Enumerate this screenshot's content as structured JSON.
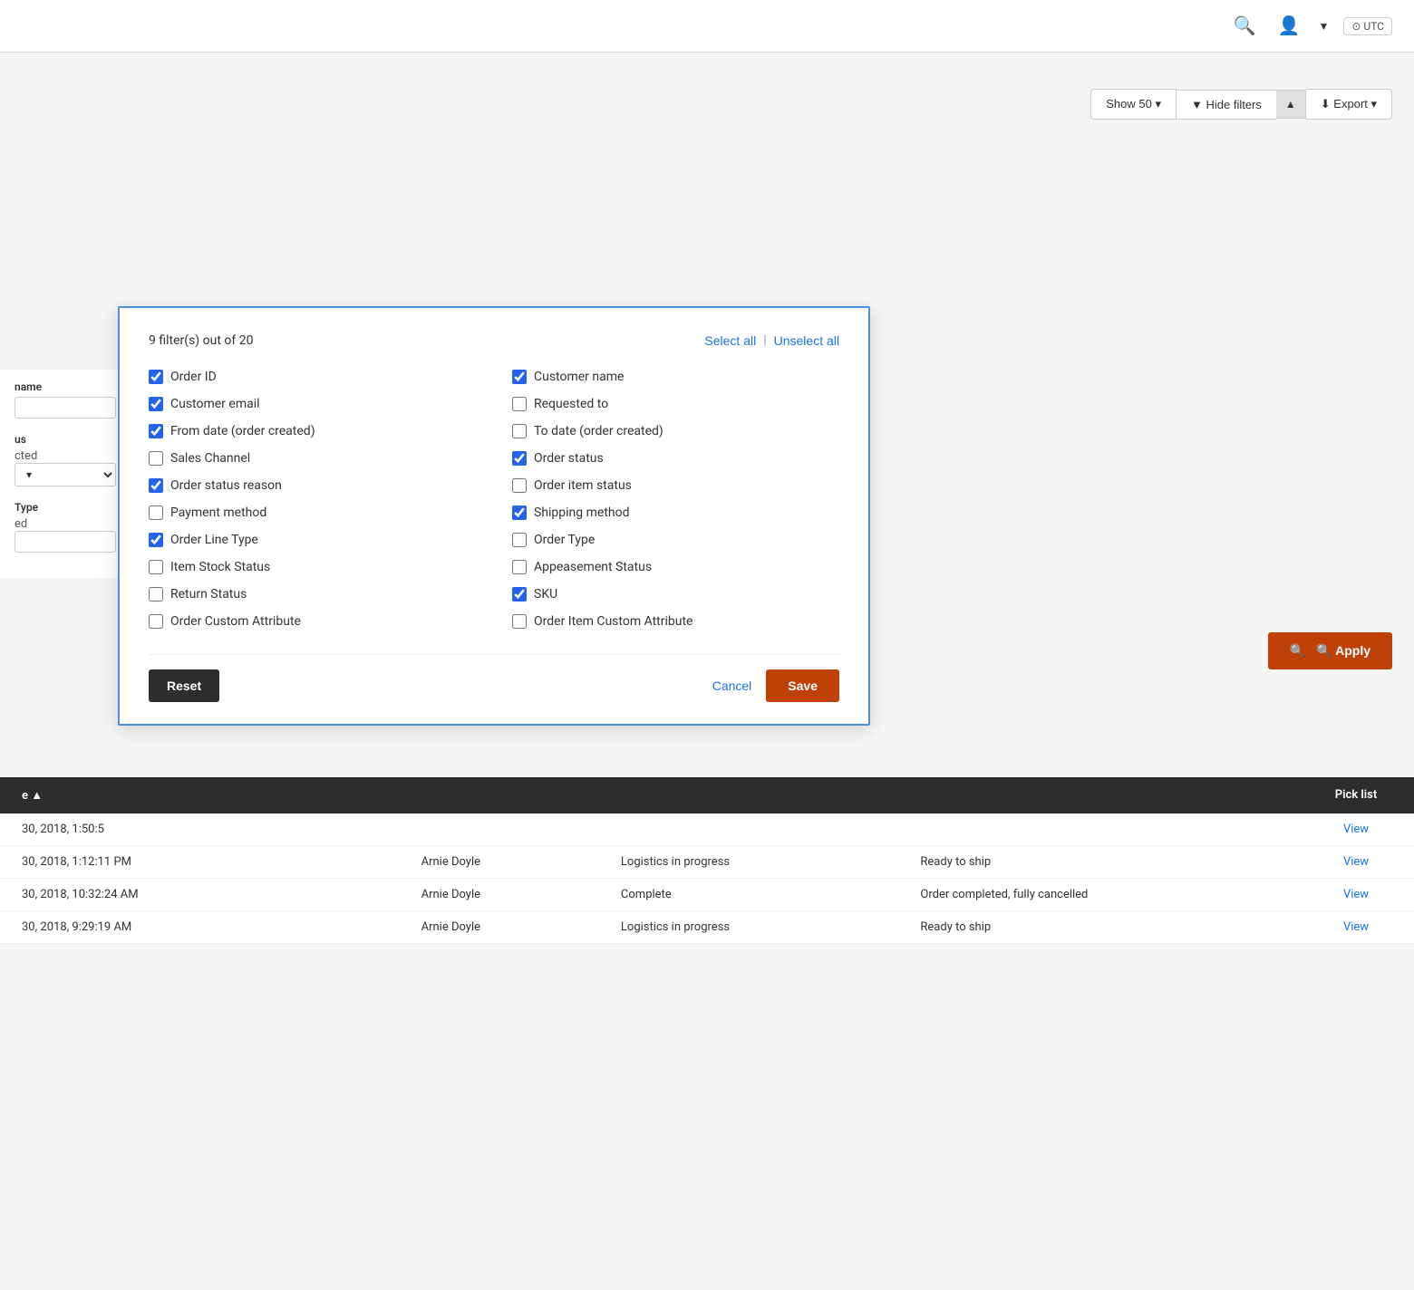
{
  "topbar": {
    "search_icon": "🔍",
    "user_icon": "👤",
    "dropdown_icon": "▼",
    "utc_label": "⊙ UTC"
  },
  "toolbar": {
    "show_label": "Show 50 ▾",
    "hide_filters_label": "▼ Hide filters",
    "collapse_icon": "▲",
    "export_label": "⬇ Export ▾"
  },
  "left_panel": {
    "name_label": "name",
    "status_label": "us",
    "status_value": "cted",
    "type_label": "Type",
    "type_value": "ed"
  },
  "modal": {
    "filter_count": "9 filter(s) out of 20",
    "select_all": "Select all",
    "unselect_all": "Unselect all",
    "filters": [
      {
        "id": "order_id",
        "label": "Order ID",
        "checked": true
      },
      {
        "id": "customer_name",
        "label": "Customer name",
        "checked": true
      },
      {
        "id": "customer_email",
        "label": "Customer email",
        "checked": true
      },
      {
        "id": "requested_to",
        "label": "Requested to",
        "checked": false
      },
      {
        "id": "from_date",
        "label": "From date (order created)",
        "checked": true
      },
      {
        "id": "to_date",
        "label": "To date (order created)",
        "checked": false
      },
      {
        "id": "sales_channel",
        "label": "Sales Channel",
        "checked": false
      },
      {
        "id": "order_status",
        "label": "Order status",
        "checked": true
      },
      {
        "id": "order_status_reason",
        "label": "Order status reason",
        "checked": true
      },
      {
        "id": "order_item_status",
        "label": "Order item status",
        "checked": false
      },
      {
        "id": "payment_method",
        "label": "Payment method",
        "checked": false
      },
      {
        "id": "shipping_method",
        "label": "Shipping method",
        "checked": true
      },
      {
        "id": "order_line_type",
        "label": "Order Line Type",
        "checked": true
      },
      {
        "id": "order_type",
        "label": "Order Type",
        "checked": false
      },
      {
        "id": "item_stock_status",
        "label": "Item Stock Status",
        "checked": false
      },
      {
        "id": "appeasement_status",
        "label": "Appeasement Status",
        "checked": false
      },
      {
        "id": "return_status",
        "label": "Return Status",
        "checked": false
      },
      {
        "id": "sku",
        "label": "SKU",
        "checked": true
      },
      {
        "id": "order_custom_attribute",
        "label": "Order Custom Attribute",
        "checked": false
      },
      {
        "id": "order_item_custom_attribute",
        "label": "Order Item Custom Attribute",
        "checked": false
      }
    ],
    "reset_label": "Reset",
    "cancel_label": "Cancel",
    "save_label": "Save"
  },
  "apply_button": {
    "label": "🔍 Apply"
  },
  "table": {
    "header": {
      "sort_col": "e ▲",
      "pick_list": "Pick list"
    },
    "rows": [
      {
        "date": "30, 2018, 1:50:5",
        "name": "",
        "status": "",
        "ship_status": "",
        "view": "View"
      },
      {
        "date": "30, 2018, 1:12:11 PM",
        "name": "Arnie Doyle",
        "status": "Logistics in progress",
        "ship_status": "Ready to ship",
        "view": "View"
      },
      {
        "date": "30, 2018, 10:32:24 AM",
        "name": "Arnie Doyle",
        "status": "Complete",
        "ship_status": "Order completed, fully cancelled",
        "view": "View"
      },
      {
        "date": "30, 2018, 9:29:19 AM",
        "name": "Arnie Doyle",
        "status": "Logistics in progress",
        "ship_status": "Ready to ship",
        "view": "View"
      }
    ]
  }
}
